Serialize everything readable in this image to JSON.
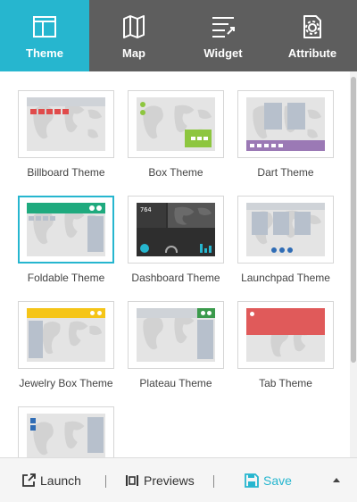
{
  "tabs": [
    {
      "label": "Theme",
      "icon": "theme-icon",
      "active": true
    },
    {
      "label": "Map",
      "icon": "map-icon",
      "active": false
    },
    {
      "label": "Widget",
      "icon": "widget-icon",
      "active": false
    },
    {
      "label": "Attribute",
      "icon": "attribute-icon",
      "active": false
    }
  ],
  "themes": [
    {
      "label": "Billboard Theme",
      "selected": false
    },
    {
      "label": "Box Theme",
      "selected": false
    },
    {
      "label": "Dart Theme",
      "selected": false
    },
    {
      "label": "Foldable Theme",
      "selected": true
    },
    {
      "label": "Dashboard Theme",
      "selected": false
    },
    {
      "label": "Launchpad Theme",
      "selected": false
    },
    {
      "label": "Jewelry Box Theme",
      "selected": false
    },
    {
      "label": "Plateau Theme",
      "selected": false
    },
    {
      "label": "Tab Theme",
      "selected": false
    },
    {
      "label": "",
      "selected": false
    }
  ],
  "dashboard_value": "764",
  "bottombar": {
    "launch": "Launch",
    "previews": "Previews",
    "save": "Save"
  },
  "colors": {
    "accent": "#26b6cf",
    "tabbar": "#5e5e5e",
    "billboard_red": "#e04b4b",
    "box_green": "#8dc63f",
    "dart_purple": "#9b79b5",
    "foldable_green": "#1faa7e",
    "launchpad_blue": "#2f6cb5",
    "jewelry_yellow": "#f5c518",
    "plateau_green": "#3b9a4c",
    "tab_red": "#e05a5a"
  }
}
